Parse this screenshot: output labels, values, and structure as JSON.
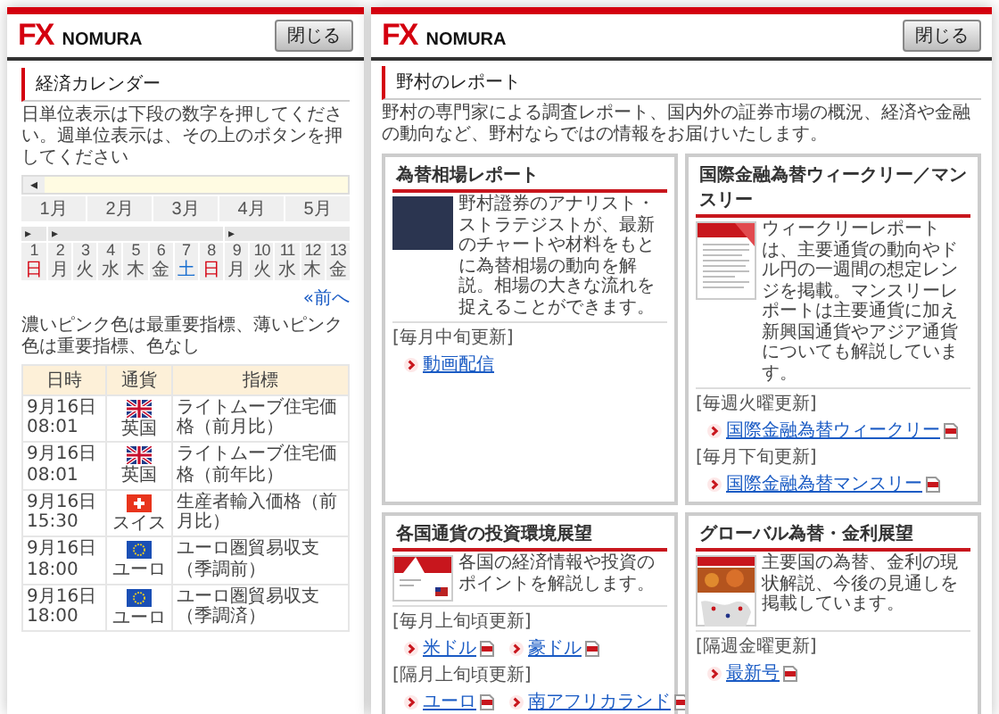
{
  "back_window": {
    "logo": {
      "mark": "FX",
      "wordmark": "NOMURA"
    },
    "close_button": "閉じる",
    "title": "経済カレンダー",
    "instructions": "日単位表示は下段の数字を押してください。週単位表示は、その上のボタンを押してください",
    "calendar": {
      "prev_button": "◂",
      "months": [
        "1月",
        "2月",
        "3月",
        "4月",
        "5月"
      ],
      "weeks": [
        {
          "button": "▸",
          "days": [
            {
              "date": "1",
              "weekday": "日",
              "kind": "sunday"
            }
          ]
        },
        {
          "button": "▸",
          "days": [
            {
              "date": "2",
              "weekday": "月",
              "kind": "weekday"
            },
            {
              "date": "3",
              "weekday": "火",
              "kind": "weekday"
            },
            {
              "date": "4",
              "weekday": "水",
              "kind": "weekday"
            },
            {
              "date": "5",
              "weekday": "木",
              "kind": "weekday"
            },
            {
              "date": "6",
              "weekday": "金",
              "kind": "weekday"
            },
            {
              "date": "7",
              "weekday": "土",
              "kind": "saturday"
            },
            {
              "date": "8",
              "weekday": "日",
              "kind": "sunday"
            }
          ]
        },
        {
          "button": "▸",
          "days": [
            {
              "date": "9",
              "weekday": "月",
              "kind": "weekday"
            },
            {
              "date": "10",
              "weekday": "火",
              "kind": "weekday"
            },
            {
              "date": "11",
              "weekday": "水",
              "kind": "weekday"
            },
            {
              "date": "12",
              "weekday": "木",
              "kind": "weekday"
            },
            {
              "date": "13",
              "weekday": "金",
              "kind": "weekday"
            }
          ]
        }
      ]
    },
    "prev_link": "«前へ",
    "legend": "濃いピンク色は最重要指標、薄いピンク色は重要指標、色なし",
    "table": {
      "columns": [
        "日時",
        "通貨",
        "指標"
      ],
      "rows": [
        {
          "datetime": "9月16日 08:01",
          "kind": "uk",
          "currency": "英国",
          "indicator": "ライトムーブ住宅価格（前月比）"
        },
        {
          "datetime": "9月16日 08:01",
          "kind": "uk",
          "currency": "英国",
          "indicator": "ライトムーブ住宅価格（前年比）"
        },
        {
          "datetime": "9月16日 15:30",
          "kind": "ch",
          "currency": "スイス",
          "indicator": "生産者輸入価格（前月比）"
        },
        {
          "datetime": "9月16日 18:00",
          "kind": "eu",
          "currency": "ユーロ",
          "indicator": "ユーロ圏貿易収支（季調前）"
        },
        {
          "datetime": "9月16日 18:00",
          "kind": "eu",
          "currency": "ユーロ",
          "indicator": "ユーロ圏貿易収支（季調済）"
        }
      ]
    }
  },
  "front_window": {
    "logo": {
      "mark": "FX",
      "wordmark": "NOMURA"
    },
    "close_button": "閉じる",
    "title": "野村のレポート",
    "intro": "野村の専門家による調査レポート、国内外の証券市場の概況、経済や金融の動向など、野村ならではの情報をお届けいたします。",
    "cards": [
      {
        "title": "為替相場レポート",
        "kind": "photo",
        "text": "野村證券のアナリスト・ストラテジストが、最新のチャートや材料をもとに為替相場の動向を解説。相場の大きな流れを捉えることができます。",
        "sections": [
          {
            "schedule": "[毎月中旬更新]",
            "links": [
              {
                "label": "動画配信",
                "pdf": false
              }
            ]
          }
        ]
      },
      {
        "title": "国際金融為替ウィークリー／マンスリー",
        "kind": "cover",
        "text": "ウィークリーレポートは、主要通貨の動向やドル円の一週間の想定レンジを掲載。マンスリーレポートは主要通貨に加え新興国通貨やアジア通貨についても解説しています。",
        "sections": [
          {
            "schedule": "[毎週火曜更新]",
            "links": [
              {
                "label": "国際金融為替ウィークリー",
                "pdf": true
              }
            ]
          },
          {
            "schedule": "[毎月下旬更新]",
            "links": [
              {
                "label": "国際金融為替マンスリー",
                "pdf": true
              }
            ]
          }
        ]
      },
      {
        "title": "各国通貨の投資環境展望",
        "kind": "cover_flag",
        "text": "各国の経済情報や投資のポイントを解説します。",
        "sections": [
          {
            "schedule": "[毎月上旬頃更新]",
            "links": [
              {
                "label": "米ドル",
                "pdf": true
              },
              {
                "label": "豪ドル",
                "pdf": true
              }
            ]
          },
          {
            "schedule": "[隔月上旬頃更新]",
            "links": [
              {
                "label": "ユーロ",
                "pdf": true
              },
              {
                "label": "南アフリカランド",
                "pdf": true
              }
            ]
          }
        ]
      },
      {
        "title": "グローバル為替・金利展望",
        "kind": "cover_photo",
        "text": "主要国の為替、金利の現状解説、今後の見通しを掲載しています。",
        "sections": [
          {
            "schedule": "[隔週金曜更新]",
            "links": [
              {
                "label": "最新号",
                "pdf": true
              }
            ]
          }
        ]
      }
    ]
  }
}
